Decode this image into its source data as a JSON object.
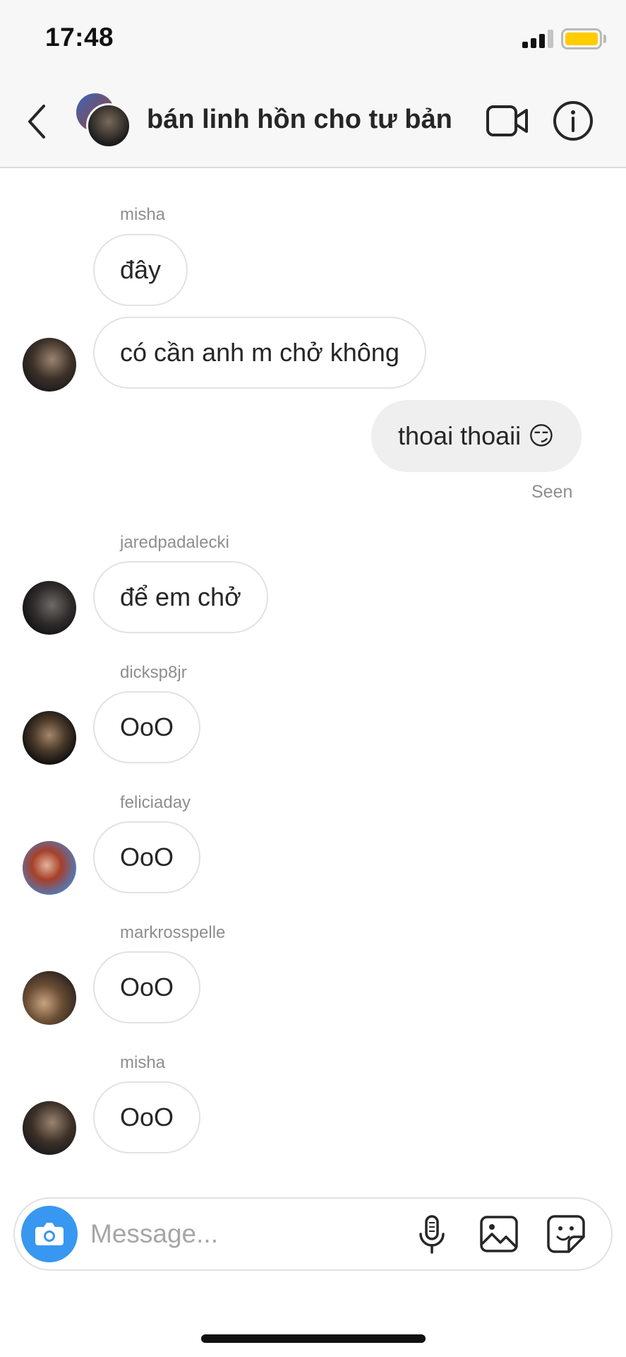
{
  "status_bar": {
    "time": "17:48"
  },
  "header": {
    "title": "bán linh hồn cho tư bản"
  },
  "messages": [
    {
      "sender": "misha",
      "text": "đây"
    },
    {
      "text": "có cần anh m chở không"
    },
    {
      "text": "thoai thoaii 😏",
      "status": "Seen"
    },
    {
      "sender": "jaredpadalecki",
      "text": "để em chở"
    },
    {
      "sender": "dicksp8jr",
      "text": "OoO"
    },
    {
      "sender": "feliciaday",
      "text": "OoO"
    },
    {
      "sender": "markrosspelle",
      "text": "OoO"
    },
    {
      "sender": "misha",
      "text": "OoO"
    }
  ],
  "composer": {
    "placeholder": "Message..."
  },
  "icons": {
    "back": "chevron-left-icon",
    "video": "video-camera-icon",
    "info": "info-icon",
    "camera": "camera-icon",
    "mic": "microphone-icon",
    "gallery": "image-icon",
    "sticker": "sticker-icon"
  },
  "colors": {
    "accent": "#3897f0",
    "battery": "#ffcc00",
    "outgoing_bubble": "#efefef",
    "meta_text": "#8e8e8e"
  }
}
